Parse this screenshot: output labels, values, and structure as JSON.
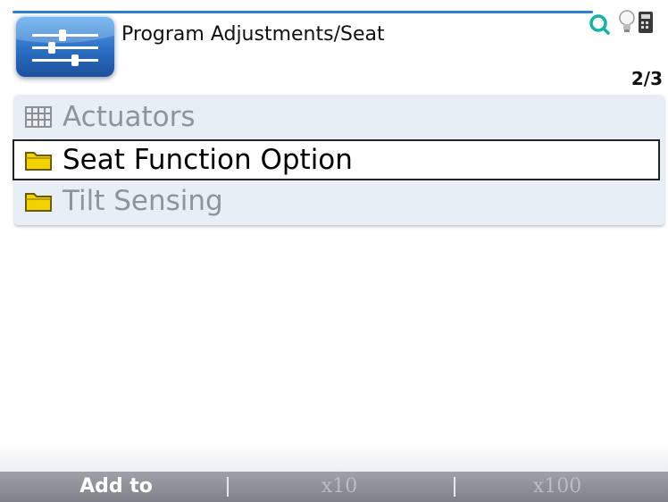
{
  "header": {
    "title": "Program Adjustments/Seat",
    "page_indicator": "2/3",
    "app_icon": "sliders-icon",
    "status_icons": [
      "search-icon",
      "lightbulb-icon",
      "calculator-icon"
    ]
  },
  "menu": {
    "items": [
      {
        "label": "Actuators",
        "icon": "grid-icon",
        "state": "disabled"
      },
      {
        "label": "Seat Function Option",
        "icon": "folder-icon",
        "state": "selected"
      },
      {
        "label": "Tilt Sensing",
        "icon": "folder-icon",
        "state": "disabled"
      }
    ]
  },
  "softkeys": {
    "left": "Add to",
    "middle": "x10",
    "right": "x100"
  },
  "colors": {
    "accent": "#2f7fd0",
    "list_background": "#e7eef5",
    "folder": "#f2d300",
    "softkey_bar": "#8a8e95"
  }
}
